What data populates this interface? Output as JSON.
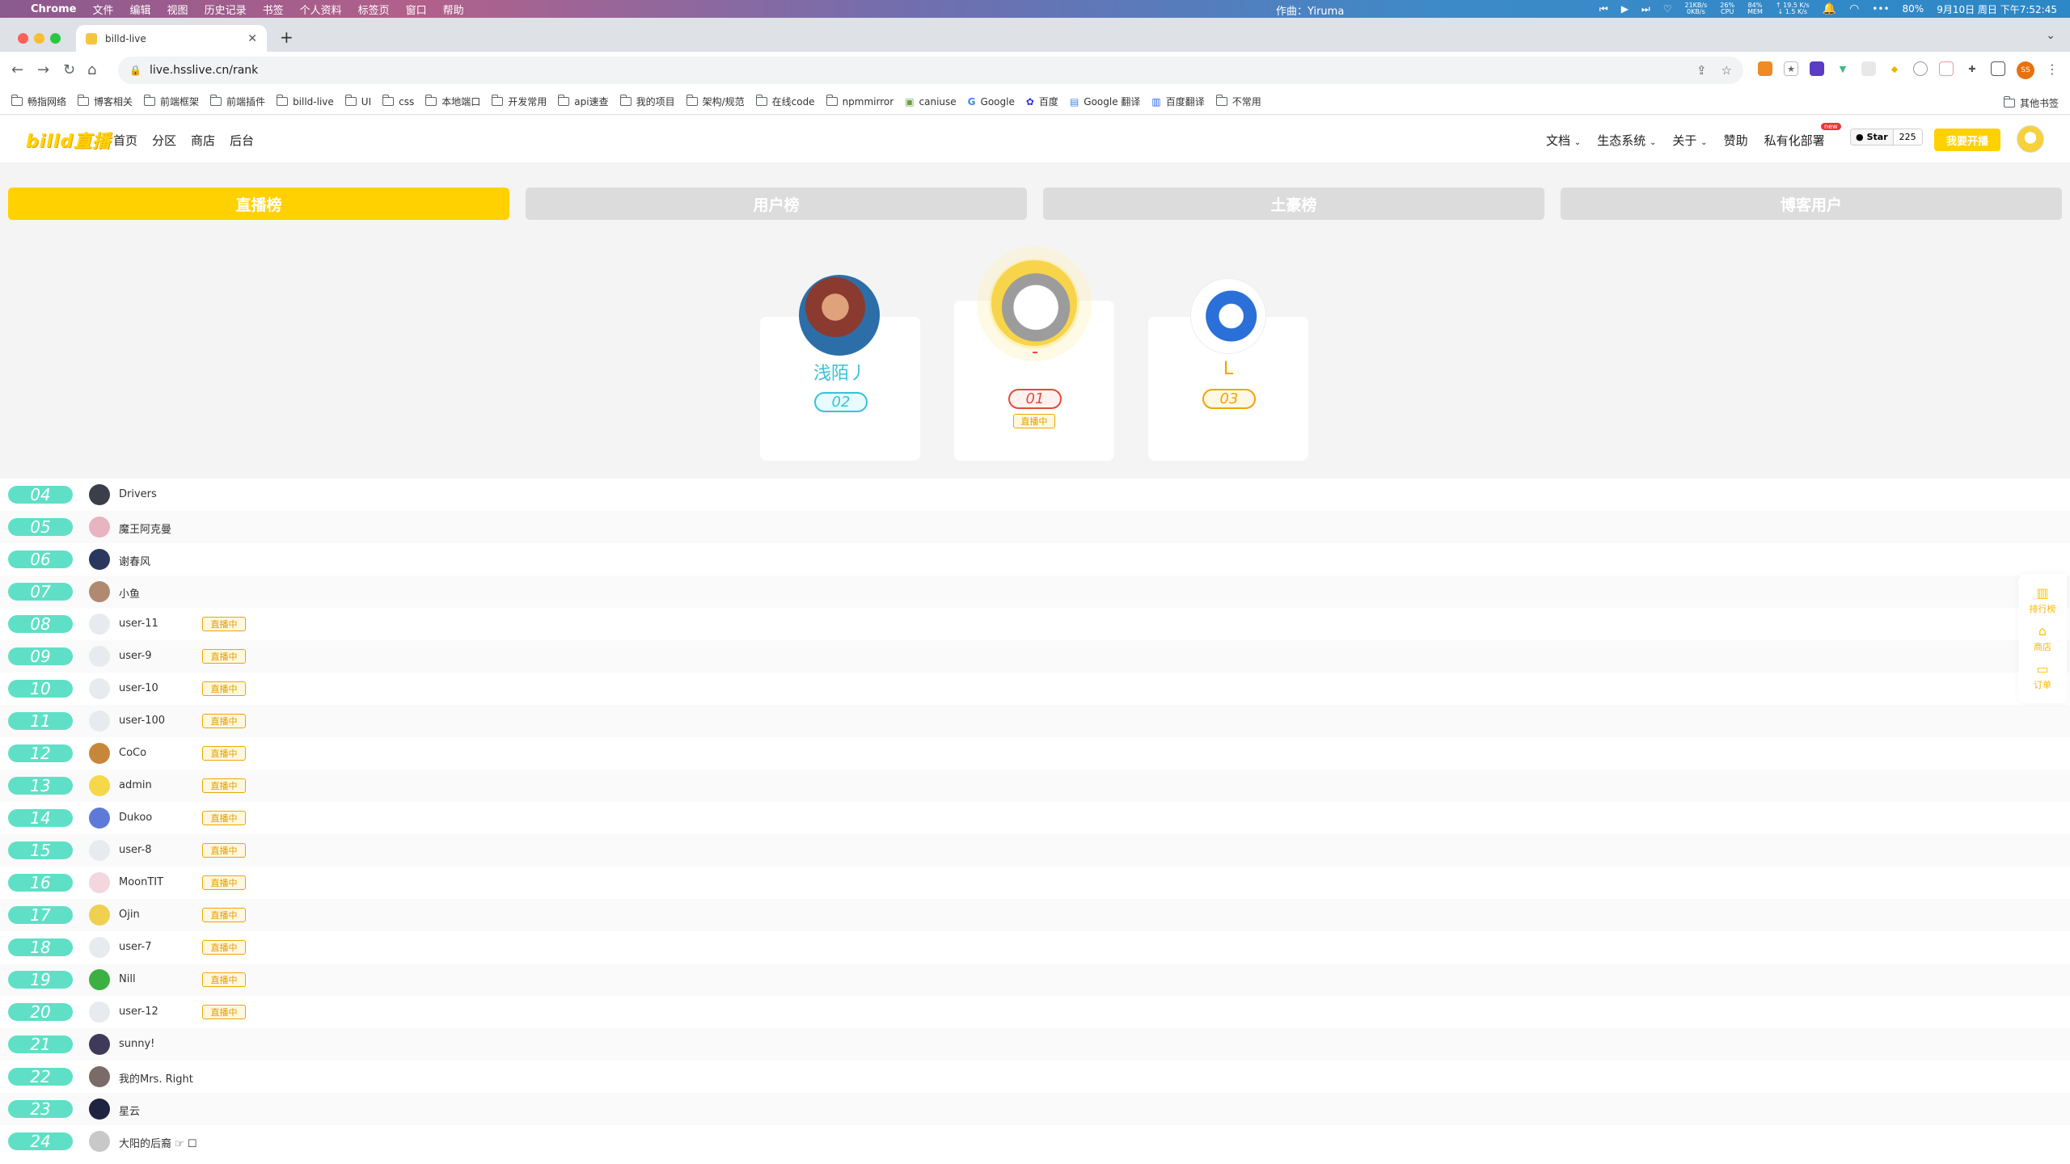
{
  "menubar": {
    "app": "Chrome",
    "menus": [
      "文件",
      "编辑",
      "视图",
      "历史记录",
      "书签",
      "个人资料",
      "标签页",
      "窗口",
      "帮助"
    ],
    "now_playing": "作曲：Yiruma",
    "net_up": "21KB/s",
    "net_down": "0KB/s",
    "cpu_pct": "26%",
    "cpu_label": "CPU",
    "mem_pct": "84%",
    "mem_label": "MEM",
    "rate_up": "↑ 19.5 K/s",
    "rate_down": "↓ 1.5 K/s",
    "battery": "80%",
    "clock": "9月10日 周日 下午7:52:45"
  },
  "browser": {
    "tab_title": "billd-live",
    "url": "live.hsslive.cn/rank",
    "profile_initials": "SS"
  },
  "bookmarks": [
    "畅指网络",
    "博客相关",
    "前端框架",
    "前端插件",
    "billd-live",
    "UI",
    "css",
    "本地端口",
    "开发常用",
    "api速查",
    "我的项目",
    "架构/规范",
    "在线code",
    "npmmirror",
    "caniuse",
    "Google",
    "百度",
    "Google 翻译",
    "百度翻译",
    "不常用"
  ],
  "bookmarks_other": "其他书签",
  "site": {
    "logo": "billd直播",
    "nav": [
      "首页",
      "分区",
      "商店",
      "后台"
    ],
    "right_nav": [
      "文档",
      "生态系统",
      "关于",
      "赞助",
      "私有化部署"
    ],
    "new_badge": "new",
    "github_star": "Star",
    "github_count": "225",
    "live_button": "我要开播"
  },
  "rank_tabs": [
    "直播榜",
    "用户榜",
    "土豪榜",
    "博客用户"
  ],
  "active_tab": "直播榜",
  "podium": {
    "first": {
      "name": "",
      "rank": "01",
      "live": "直播中"
    },
    "second": {
      "name": "浅陌丿",
      "rank": "02"
    },
    "third": {
      "name": "L",
      "rank": "03"
    }
  },
  "rows": [
    {
      "rank": "04",
      "name": "Drivers",
      "live": "",
      "avatar": "#3a3f4a"
    },
    {
      "rank": "05",
      "name": "魔王阿克曼",
      "live": "",
      "avatar": "#e8b4c0"
    },
    {
      "rank": "06",
      "name": "谢春风",
      "live": "",
      "avatar": "#2a3860"
    },
    {
      "rank": "07",
      "name": "小鱼",
      "live": "",
      "avatar": "#b08a70"
    },
    {
      "rank": "08",
      "name": "user-11",
      "live": "直播中",
      "avatar": "#e7ebf0"
    },
    {
      "rank": "09",
      "name": "user-9",
      "live": "直播中",
      "avatar": "#e7ebf0"
    },
    {
      "rank": "10",
      "name": "user-10",
      "live": "直播中",
      "avatar": "#e7ebf0"
    },
    {
      "rank": "11",
      "name": "user-100",
      "live": "直播中",
      "avatar": "#e7ebf0"
    },
    {
      "rank": "12",
      "name": "CoCo",
      "live": "直播中",
      "avatar": "#c7873b"
    },
    {
      "rank": "13",
      "name": "admin",
      "live": "直播中",
      "avatar": "#f5d84a"
    },
    {
      "rank": "14",
      "name": "Dukoo",
      "live": "直播中",
      "avatar": "#5d7ad8"
    },
    {
      "rank": "15",
      "name": "user-8",
      "live": "直播中",
      "avatar": "#e7ebf0"
    },
    {
      "rank": "16",
      "name": "MoonTIT",
      "live": "直播中",
      "avatar": "#f3d6de"
    },
    {
      "rank": "17",
      "name": "Ojin",
      "live": "直播中",
      "avatar": "#f0d050"
    },
    {
      "rank": "18",
      "name": "user-7",
      "live": "直播中",
      "avatar": "#e7ebf0"
    },
    {
      "rank": "19",
      "name": "Nill",
      "live": "直播中",
      "avatar": "#3cb043"
    },
    {
      "rank": "20",
      "name": "user-12",
      "live": "直播中",
      "avatar": "#e7ebf0"
    },
    {
      "rank": "21",
      "name": "sunny!",
      "live": "",
      "avatar": "#403a5a"
    },
    {
      "rank": "22",
      "name": "我的Mrs. Right",
      "live": "",
      "avatar": "#7a6a68"
    },
    {
      "rank": "23",
      "name": "星云",
      "live": "",
      "avatar": "#1f2440"
    },
    {
      "rank": "24",
      "name": "大阳的后裔 ☞ ☐",
      "live": "",
      "avatar": "#c8c8c8"
    }
  ],
  "side_float": [
    "排行榜",
    "商店",
    "订单"
  ]
}
